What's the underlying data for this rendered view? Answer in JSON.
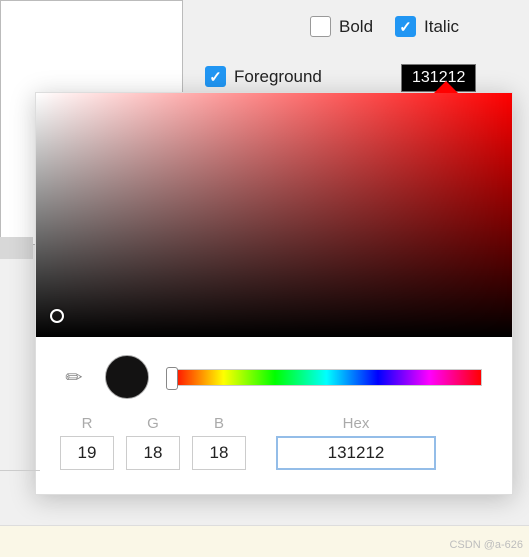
{
  "options": {
    "bold_label": "Bold",
    "bold_checked": false,
    "italic_label": "Italic",
    "italic_checked": true
  },
  "foreground": {
    "label": "Foreground",
    "checked": true,
    "hex_badge": "131212"
  },
  "picker": {
    "rgb": {
      "r_label": "R",
      "g_label": "G",
      "b_label": "B",
      "r": "19",
      "g": "18",
      "b": "18"
    },
    "hex_label": "Hex",
    "hex_value": "131212",
    "swatch_color": "#131212"
  },
  "watermark": "CSDN @a-626"
}
